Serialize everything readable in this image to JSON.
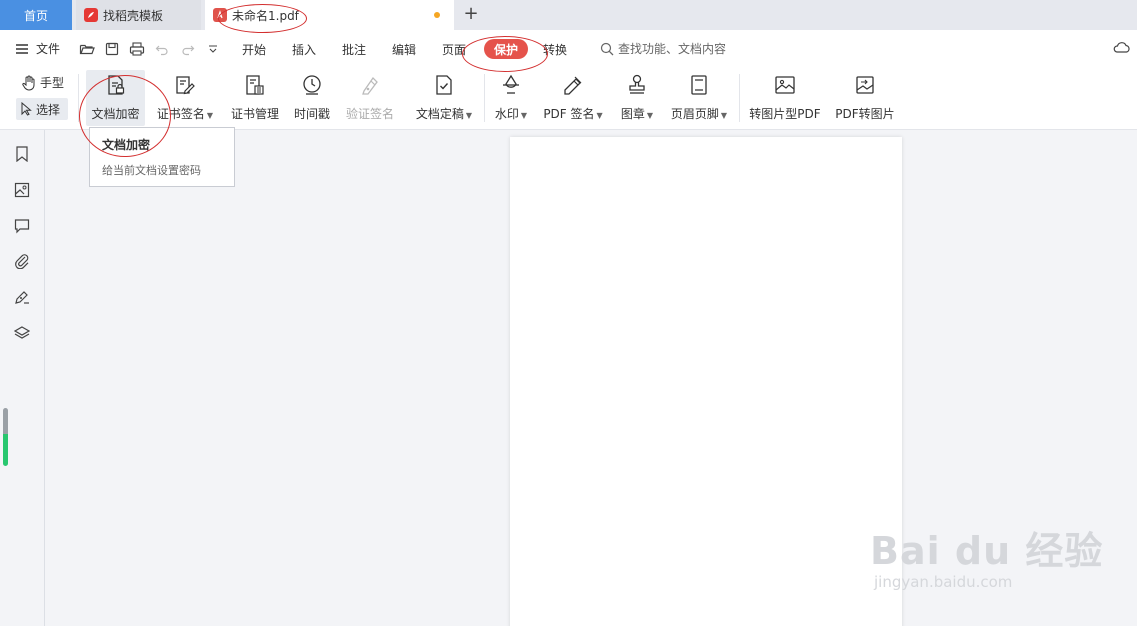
{
  "tabs": {
    "home": "首页",
    "template": "找稻壳模板",
    "document": "未命名1.pdf",
    "add": "+"
  },
  "menubar": {
    "file": "文件",
    "items": [
      "开始",
      "插入",
      "批注",
      "编辑",
      "页面",
      "保护",
      "转换"
    ],
    "active": "保护",
    "search_placeholder": "查找功能、文档内容"
  },
  "tools": {
    "hand": "手型",
    "select": "选择"
  },
  "ribbon": {
    "buttons": [
      {
        "label": "文档加密",
        "icon": "lock-document-icon",
        "dropdown": false,
        "active": true
      },
      {
        "label": "证书签名",
        "icon": "certificate-sign-icon",
        "dropdown": true
      },
      {
        "label": "证书管理",
        "icon": "certificate-manage-icon",
        "dropdown": false
      },
      {
        "label": "时间戳",
        "icon": "clock-stamp-icon",
        "dropdown": false
      },
      {
        "label": "验证签名",
        "icon": "verify-signature-icon",
        "dropdown": false,
        "disabled": true
      },
      {
        "label": "文档定稿",
        "icon": "finalize-document-icon",
        "dropdown": true
      },
      {
        "label": "水印",
        "icon": "watermark-icon",
        "dropdown": true
      },
      {
        "label": "PDF 签名",
        "icon": "pdf-sign-icon",
        "dropdown": true
      },
      {
        "label": "图章",
        "icon": "stamp-icon",
        "dropdown": true
      },
      {
        "label": "页眉页脚",
        "icon": "header-footer-icon",
        "dropdown": true
      },
      {
        "label": "转图片型PDF",
        "icon": "image-pdf-icon",
        "dropdown": false
      },
      {
        "label": "PDF转图片",
        "icon": "pdf-to-image-icon",
        "dropdown": false
      }
    ]
  },
  "tooltip": {
    "title": "文档加密",
    "description": "给当前文档设置密码"
  },
  "sidebar": {
    "icons": [
      "bookmark-icon",
      "image-icon",
      "comment-icon",
      "attachment-icon",
      "signature-pen-icon",
      "layers-icon"
    ]
  },
  "watermark": {
    "main": "Bai du 经验",
    "sub": "jingyan.baidu.com"
  },
  "colors": {
    "accent_blue": "#4a90e2",
    "active_red": "#e5534b",
    "modified_dot": "#f5a623"
  }
}
